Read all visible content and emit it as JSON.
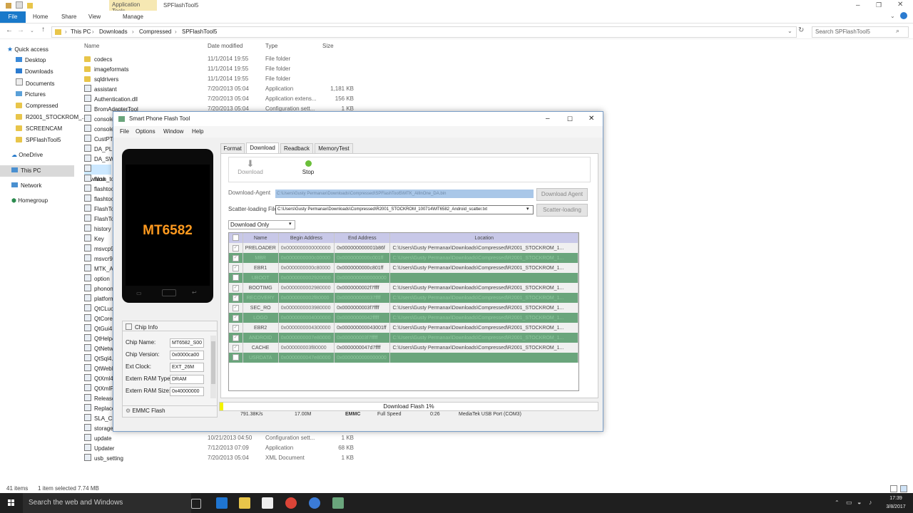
{
  "explorer": {
    "app_tools": "Application Tools",
    "title": "SPFlashTool5",
    "tabs": [
      "File",
      "Home",
      "Share",
      "View",
      "Manage"
    ],
    "breadcrumb": [
      "This PC",
      "Downloads",
      "Compressed",
      "SPFlashTool5"
    ],
    "search_placeholder": "Search SPFlashTool5",
    "columns": [
      "Name",
      "Date modified",
      "Type",
      "Size"
    ],
    "nav": [
      "Quick access",
      "Desktop",
      "Downloads",
      "Documents",
      "Pictures",
      "Compressed",
      "R2001_STOCKROM_...",
      "SCREENCAM",
      "SPFlashTool5",
      "OneDrive",
      "This PC",
      "Network",
      "Homegroup"
    ],
    "files_top": [
      {
        "name": "codecs",
        "date": "11/1/2014 19:55",
        "type": "File folder",
        "size": ""
      },
      {
        "name": "imageformats",
        "date": "11/1/2014 19:55",
        "type": "File folder",
        "size": ""
      },
      {
        "name": "sqldrivers",
        "date": "11/1/2014 19:55",
        "type": "File folder",
        "size": ""
      },
      {
        "name": "assistant",
        "date": "7/20/2013 05:04",
        "type": "Application",
        "size": "1,181 KB"
      },
      {
        "name": "Authentication.dll",
        "date": "7/20/2013 05:04",
        "type": "Application extens...",
        "size": "156 KB"
      },
      {
        "name": "BromAdapterTool",
        "date": "7/20/2013 05:04",
        "type": "Configuration sett...",
        "size": "1 KB"
      }
    ],
    "files_left": [
      "console",
      "console",
      "CustPT",
      "DA_PL.b",
      "DA_SWS",
      "downloa",
      "flash_to",
      "flashtoo",
      "flashtoo",
      "FlashToo",
      "FlashToo",
      "history",
      "Key",
      "msvcp90",
      "msvcr90",
      "MTK_All",
      "option",
      "phonon",
      "platform",
      "QtCLuce",
      "QtCore4",
      "QtGui4.",
      "QtHelp4",
      "QtNetw",
      "QtSql4.",
      "QtWebK",
      "QtXml4.",
      "QtXmlP",
      "Release",
      "Replacel",
      "SLA_Cha",
      "storage_"
    ],
    "files_bottom": [
      {
        "name": "update",
        "date": "10/21/2013 04:50",
        "type": "Configuration sett...",
        "size": "1 KB"
      },
      {
        "name": "Updater",
        "date": "7/12/2013 07:09",
        "type": "Application",
        "size": "68 KB"
      },
      {
        "name": "usb_setting",
        "date": "7/20/2013 05:04",
        "type": "XML Document",
        "size": "1 KB"
      }
    ],
    "status_items": "41 items",
    "status_sel": "1 item selected  7.74 MB"
  },
  "taskbar": {
    "search": "Search the web and Windows",
    "time": "17:39",
    "date": "3/8/2017"
  },
  "tool": {
    "title": "Smart Phone Flash Tool",
    "menu": [
      "File",
      "Options",
      "Window",
      "Help"
    ],
    "phone_label": "MT6582",
    "chip_title": "Chip Info",
    "chip_fields": [
      {
        "label": "Chip Name:",
        "value": "MT6582_S00"
      },
      {
        "label": "Chip Version:",
        "value": "0x0000ca00"
      },
      {
        "label": "Ext Clock:",
        "value": "EXT_26M"
      },
      {
        "label": "Extern RAM Type:",
        "value": "DRAM"
      },
      {
        "label": "Extern RAM Size:",
        "value": "0x40000000"
      }
    ],
    "emmc_flash": "EMMC Flash",
    "tabs": [
      "Format",
      "Download",
      "Readback",
      "MemoryTest"
    ],
    "active_tab": "Download",
    "download_btn": "Download",
    "stop_btn": "Stop",
    "da_label": "Download-Agent",
    "da_path": "C:\\Users\\Gusty Permanax\\Downloads\\Compressed\\SPFlashTool5\\MTK_AllInOne_DA.bin",
    "da_button": "Download Agent",
    "scatter_label": "Scatter-loading File",
    "scatter_path": "C:\\Users\\Gusty Permanax\\Downloads\\Compressed\\R2001_STOCKROM_100714\\MT6582_Android_scatter.txt",
    "scatter_button": "Scatter-loading",
    "mode": "Download Only",
    "table_headers": [
      "Name",
      "Begin Address",
      "End Address",
      "Location"
    ],
    "rows": [
      {
        "name": "PRELOADER",
        "begin": "0x0000000000000000",
        "end": "0x000000000001b86f",
        "loc": "C:\\Users\\Gusty Permanax\\Downloads\\Compressed\\R2001_STOCKROM_1...",
        "green": false
      },
      {
        "name": "MBR",
        "begin": "0x0000000000c00000",
        "end": "0x0000000000c001ff",
        "loc": "C:\\Users\\Gusty Permanax\\Downloads\\Compressed\\R2001_STOCKROM_1...",
        "green": true
      },
      {
        "name": "EBR1",
        "begin": "0x0000000000c80000",
        "end": "0x0000000000c801ff",
        "loc": "C:\\Users\\Gusty Permanax\\Downloads\\Compressed\\R2001_STOCKROM_1...",
        "green": false
      },
      {
        "name": "UBOOT",
        "begin": "0x0000000002920000",
        "end": "0x0000000000000000",
        "loc": "",
        "green": true
      },
      {
        "name": "BOOTIMG",
        "begin": "0x0000000002980000",
        "end": "0x0000000002f7ffff",
        "loc": "C:\\Users\\Gusty Permanax\\Downloads\\Compressed\\R2001_STOCKROM_1...",
        "green": false
      },
      {
        "name": "RECOVERY",
        "begin": "0x0000000002f80000",
        "end": "0x000000000037ffff",
        "loc": "C:\\Users\\Gusty Permanax\\Downloads\\Compressed\\R2001_STOCKROM_1...",
        "green": true
      },
      {
        "name": "SEC_RO",
        "begin": "0x0000000003980000",
        "end": "0x0000000003f7ffff",
        "loc": "C:\\Users\\Gusty Permanax\\Downloads\\Compressed\\R2001_STOCKROM_1...",
        "green": false
      },
      {
        "name": "LOGO",
        "begin": "0x0000000004000000",
        "end": "0x00000000042fffff",
        "loc": "C:\\Users\\Gusty Permanax\\Downloads\\Compressed\\R2001_STOCKROM_1...",
        "green": true
      },
      {
        "name": "EBR2",
        "begin": "0x0000000004300000",
        "end": "0x000000000043001ff",
        "loc": "C:\\Users\\Gusty Permanax\\Downloads\\Compressed\\R2001_STOCKROM_1...",
        "green": false
      },
      {
        "name": "ANDROID",
        "begin": "0x0000000007e80000",
        "end": "0x000000003f7fffff",
        "loc": "C:\\Users\\Gusty Permanax\\Downloads\\Compressed\\R2001_STOCKROM_1...",
        "green": true
      },
      {
        "name": "CACHE",
        "begin": "0x000000003f80000",
        "end": "0x0000000047d7ffff",
        "loc": "C:\\Users\\Gusty Permanax\\Downloads\\Compressed\\R2001_STOCKROM_1...",
        "green": false
      },
      {
        "name": "USRDATA",
        "begin": "0x0000000047e80000",
        "end": "0x0000000000000000",
        "loc": "",
        "green": true
      }
    ],
    "progress_label": "Download Flash 1%",
    "progress": 0.01,
    "status": [
      "791.38K/s",
      "17.00M",
      "EMMC",
      "Full Speed",
      "0:26",
      "MediaTek USB Port (COM3)"
    ],
    "colors": {
      "green_row": "#6aa57c",
      "progress": "#f3f300",
      "header": "#c8c8e8"
    }
  }
}
